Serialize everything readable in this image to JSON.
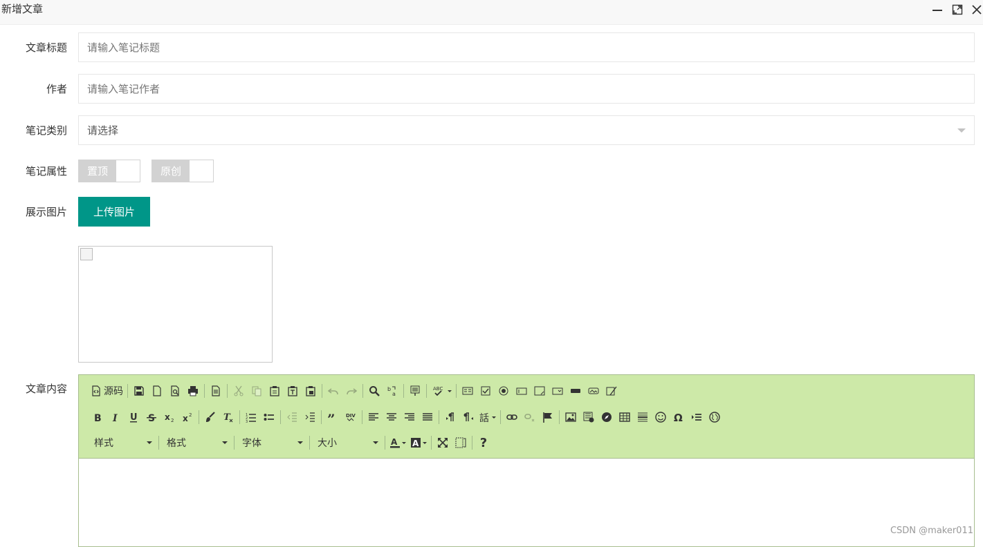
{
  "window": {
    "title": "新增文章",
    "minimize_icon": "minimize-icon",
    "maximize_icon": "maximize-icon",
    "close_icon": "close-icon"
  },
  "form": {
    "title": {
      "label": "文章标题",
      "placeholder": "请输入笔记标题",
      "value": ""
    },
    "author": {
      "label": "作者",
      "placeholder": "请输入笔记作者",
      "value": ""
    },
    "category": {
      "label": "笔记类别",
      "selected": "请选择"
    },
    "attributes": {
      "label": "笔记属性",
      "switches": [
        {
          "label": "置顶",
          "on": false
        },
        {
          "label": "原创",
          "on": false
        }
      ]
    },
    "image": {
      "label": "展示图片",
      "upload_label": "上传图片"
    },
    "content": {
      "label": "文章内容"
    }
  },
  "editor": {
    "source_label": "源码",
    "styles_label": "样式",
    "format_label": "格式",
    "font_label": "字体",
    "size_label": "大小",
    "help_label": "?"
  },
  "colors": {
    "primary": "#009688",
    "toolbar_bg": "#cde9a8",
    "switch_off": "#d2d2d2"
  },
  "watermark": "CSDN @maker011"
}
